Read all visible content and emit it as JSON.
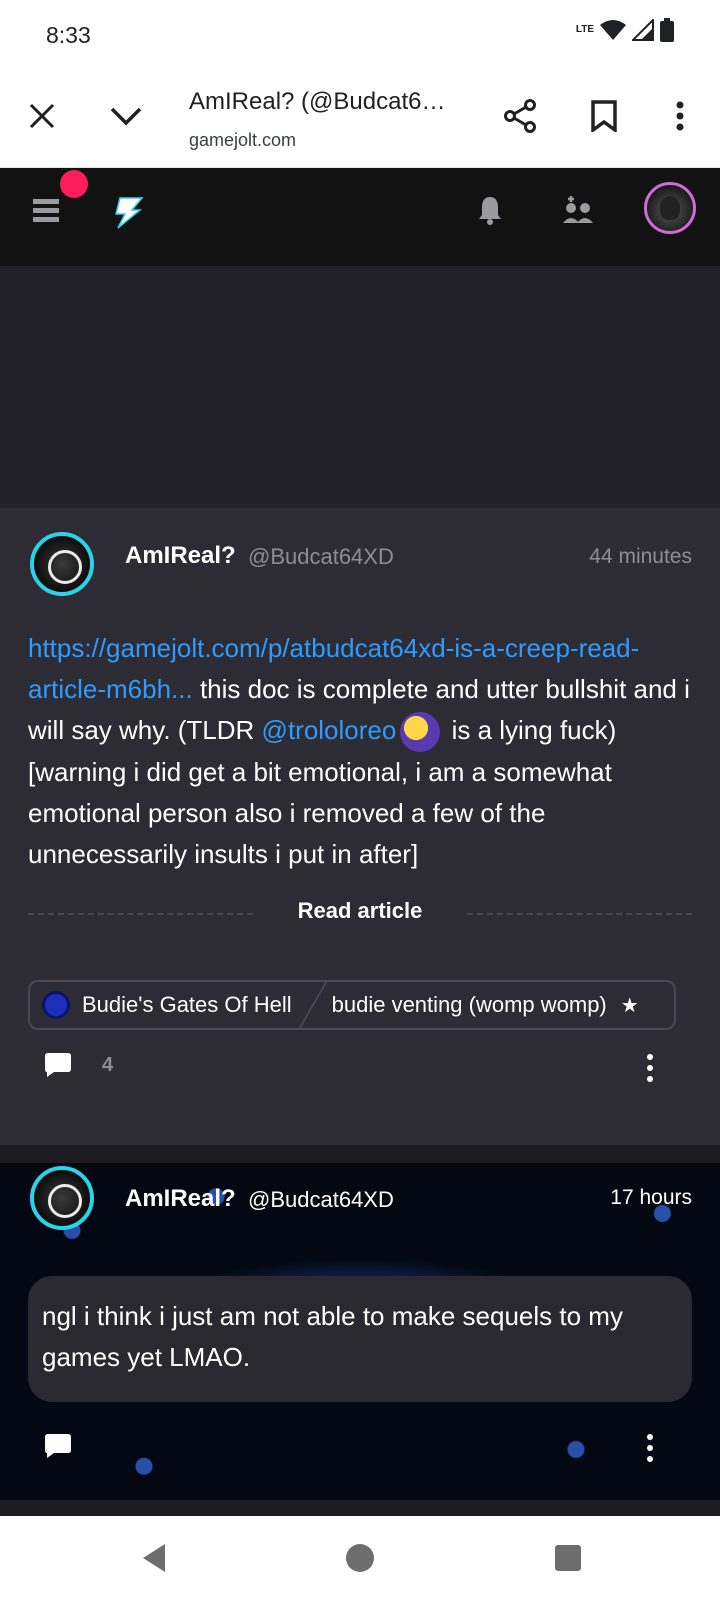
{
  "status_bar": {
    "time": "8:33",
    "network": "LTE"
  },
  "browser": {
    "tab_title": "AmIReal? (@Budcat6…",
    "url": "gamejolt.com"
  },
  "post1": {
    "author_name": "AmIReal?",
    "author_handle": "@Budcat64XD",
    "time": "44 minutes",
    "link_text": "https://gamejolt.com/p/atbudcat64xd-is-a-creep-read-article-m6bh...",
    "body_part1": " this doc is complete and utter bullshit and i will say why. (TLDR ",
    "mention": "@trololoreo",
    "body_part2": " is a lying fuck) [warning i did get a bit emotional, i am a somewhat emotional person also i removed a few of the unnecessarily insults i put in after]",
    "read_article_label": "Read article",
    "community_name": "Budie's Gates Of Hell",
    "channel_name": "budie venting (womp womp)",
    "comment_count": "4"
  },
  "post2": {
    "author_name": "AmIReal?",
    "author_handle": "@Budcat64XD",
    "time": "17 hours",
    "body": "ngl i think i just am not able to make sequels to my games yet LMAO."
  },
  "colors": {
    "link": "#2f9bff",
    "notification_dot": "#ff1c5c",
    "avatar_ring": "#2bd3e8",
    "card_bg": "#2d2c34",
    "header_bg": "#121212"
  }
}
